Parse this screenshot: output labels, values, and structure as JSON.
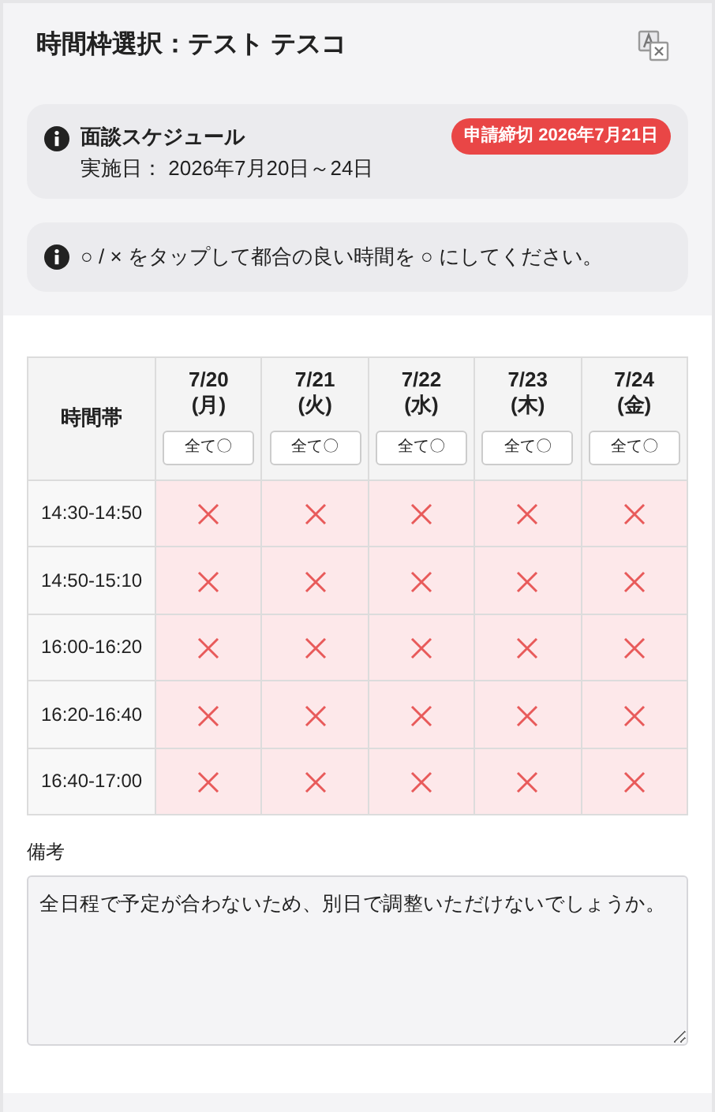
{
  "header": {
    "title": "時間枠選択：テスト テスコ"
  },
  "schedule": {
    "title": "面談スケジュール",
    "dates": "実施日： 2026年7月20日～24日",
    "deadline": "申請締切 2026年7月21日"
  },
  "instruction": "○ / × をタップして都合の良い時間を ○ にしてください。",
  "table": {
    "corner": "時間帯",
    "days": [
      {
        "date": "7/20",
        "weekday": "(月)",
        "all_button": "全て〇"
      },
      {
        "date": "7/21",
        "weekday": "(火)",
        "all_button": "全て〇"
      },
      {
        "date": "7/22",
        "weekday": "(水)",
        "all_button": "全て〇"
      },
      {
        "date": "7/23",
        "weekday": "(木)",
        "all_button": "全て〇"
      },
      {
        "date": "7/24",
        "weekday": "(金)",
        "all_button": "全て〇"
      }
    ],
    "rows": [
      {
        "time": "14:30-14:50",
        "slots": [
          {
            "available": false
          },
          {
            "available": false
          },
          {
            "available": false
          },
          {
            "available": false
          },
          {
            "available": false
          }
        ]
      },
      {
        "time": "14:50-15:10",
        "slots": [
          {
            "available": false
          },
          {
            "available": false
          },
          {
            "available": false
          },
          {
            "available": false
          },
          {
            "available": false
          }
        ]
      },
      {
        "time": "16:00-16:20",
        "slots": [
          {
            "available": false
          },
          {
            "available": false
          },
          {
            "available": false
          },
          {
            "available": false
          },
          {
            "available": false
          }
        ]
      },
      {
        "time": "16:20-16:40",
        "slots": [
          {
            "available": false
          },
          {
            "available": false
          },
          {
            "available": false
          },
          {
            "available": false
          },
          {
            "available": false
          }
        ]
      },
      {
        "time": "16:40-17:00",
        "slots": [
          {
            "available": false
          },
          {
            "available": false
          },
          {
            "available": false
          },
          {
            "available": false
          },
          {
            "available": false
          }
        ]
      }
    ]
  },
  "remarks": {
    "label": "備考",
    "value": "全日程で予定が合わないため、別日で調整いただけないでしょうか。"
  }
}
